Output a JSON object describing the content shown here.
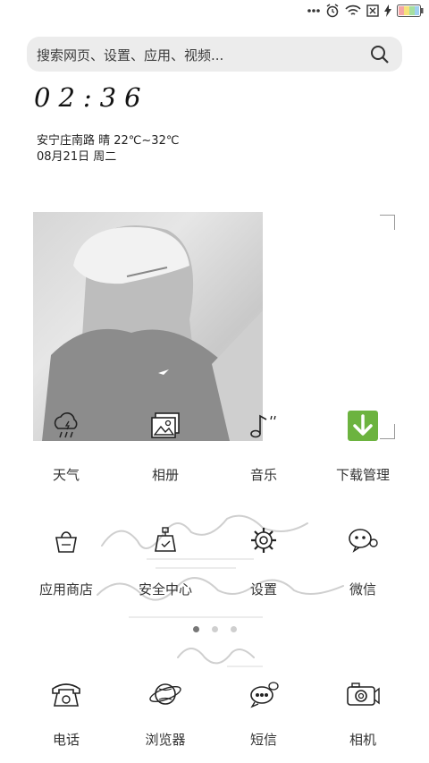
{
  "search": {
    "placeholder": "搜索网页、设置、应用、视频..."
  },
  "clock": {
    "time": "02:36"
  },
  "weather": {
    "text": "安宁庄南路  晴  22℃~32℃"
  },
  "date": {
    "text": "08月21日 周二"
  },
  "apps": [
    {
      "label": "天气",
      "icon": "weather-icon"
    },
    {
      "label": "相册",
      "icon": "gallery-icon"
    },
    {
      "label": "音乐",
      "icon": "music-icon"
    },
    {
      "label": "下载管理",
      "icon": "download-icon"
    },
    {
      "label": "应用商店",
      "icon": "app-store-icon"
    },
    {
      "label": "安全中心",
      "icon": "security-icon"
    },
    {
      "label": "设置",
      "icon": "settings-icon"
    },
    {
      "label": "微信",
      "icon": "wechat-icon"
    },
    {
      "label": "电话",
      "icon": "phone-icon"
    },
    {
      "label": "浏览器",
      "icon": "browser-icon"
    },
    {
      "label": "短信",
      "icon": "sms-icon"
    },
    {
      "label": "相机",
      "icon": "camera-icon"
    }
  ],
  "pager": {
    "count": 3,
    "active_index": 0
  },
  "colors": {
    "download_green": "#6cb33f",
    "search_bg": "#ececec"
  }
}
